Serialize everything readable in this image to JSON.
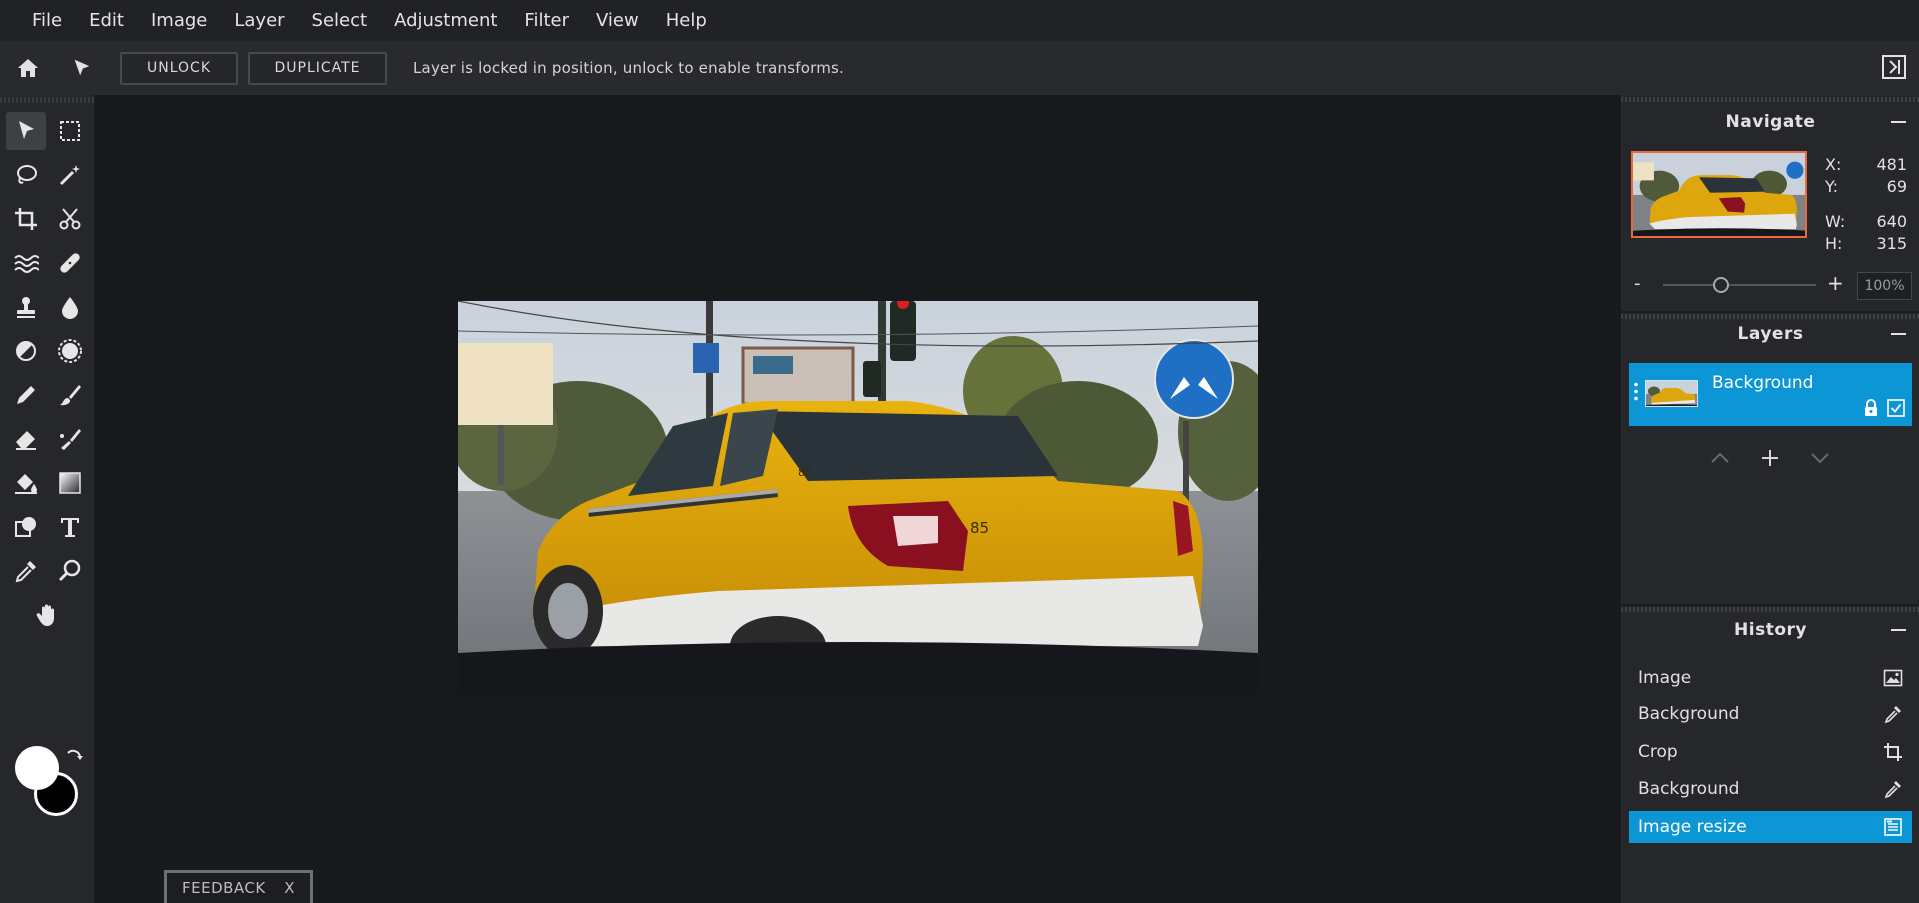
{
  "menu": [
    "File",
    "Edit",
    "Image",
    "Layer",
    "Select",
    "Adjustment",
    "Filter",
    "View",
    "Help"
  ],
  "toolbar": {
    "unlock_label": "UNLOCK",
    "duplicate_label": "DUPLICATE",
    "message": "Layer is locked in position, unlock to enable transforms."
  },
  "tools": [
    "move",
    "marquee",
    "lasso",
    "magic-wand",
    "crop",
    "cut",
    "liquify",
    "healing",
    "stamp",
    "blur",
    "dodge-burn",
    "sponge",
    "pencil",
    "brush",
    "eraser",
    "smudge",
    "fill",
    "gradient",
    "shape",
    "text",
    "eyedropper",
    "zoom",
    "hand"
  ],
  "colors": {
    "foreground": "#ffffff",
    "background": "#000000",
    "accent": "#0d96d6"
  },
  "navigate": {
    "title": "Navigate",
    "x_label": "X:",
    "x_value": "481",
    "y_label": "Y:",
    "y_value": "69",
    "w_label": "W:",
    "w_value": "640",
    "h_label": "H:",
    "h_value": "315",
    "zoom_minus": "-",
    "zoom_plus": "+",
    "zoom_value": "100%"
  },
  "layers": {
    "title": "Layers",
    "items": [
      {
        "name": "Background",
        "locked": true,
        "visible": true
      }
    ]
  },
  "history": {
    "title": "History",
    "items": [
      {
        "label": "Image",
        "icon": "image-icon"
      },
      {
        "label": "Background",
        "icon": "eyedropper-icon"
      },
      {
        "label": "Crop",
        "icon": "crop-icon"
      },
      {
        "label": "Background",
        "icon": "eyedropper-icon"
      },
      {
        "label": "Image resize",
        "icon": "document-icon"
      }
    ]
  },
  "feedback": {
    "label": "FEEDBACK",
    "close": "X"
  }
}
